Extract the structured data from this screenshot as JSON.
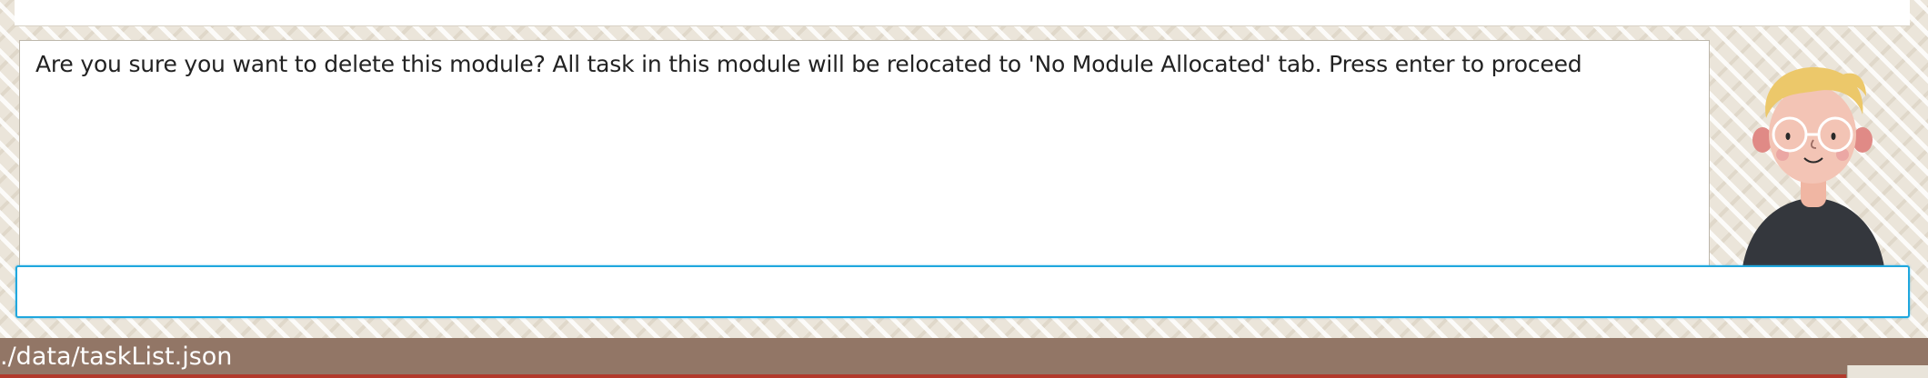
{
  "dialog": {
    "message": "Are you sure you want to delete this module? All task in this module will be relocated to 'No Module Allocated' tab. Press enter to proceed"
  },
  "command_input": {
    "value": "",
    "placeholder": ""
  },
  "status_bar": {
    "path": "./data/taskList.json"
  },
  "colors": {
    "input_focus_border": "#1fa7de",
    "status_bar_bg": "#927666",
    "status_bar_accent": "#b23a2c"
  },
  "icons": {
    "avatar": "character-avatar-icon"
  }
}
